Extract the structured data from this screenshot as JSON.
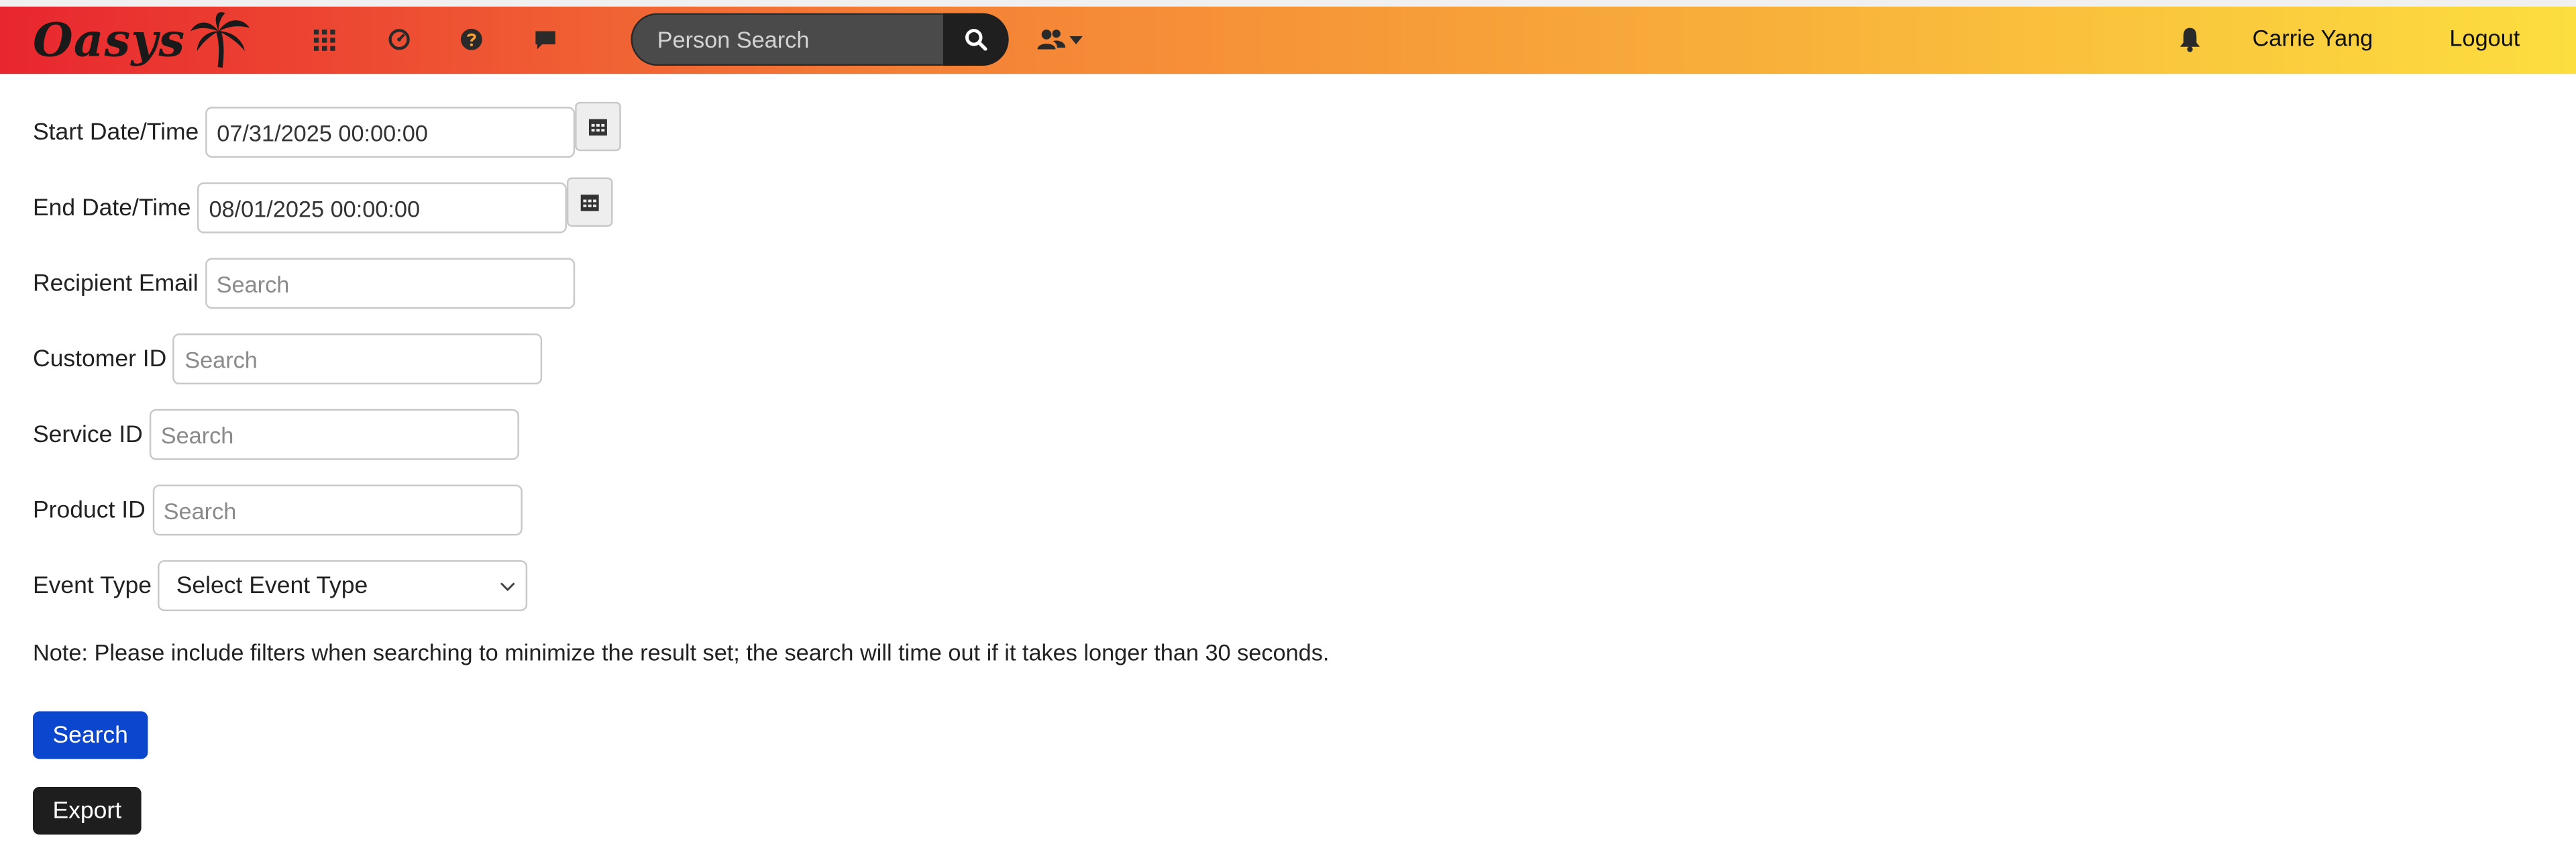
{
  "colors": {
    "navbar_gradient_start": "#e8262f",
    "navbar_gradient_mid": "#f47f36",
    "navbar_gradient_end": "#fcde3f",
    "search_button": "#0b46cf",
    "export_button": "#1e1e1e"
  },
  "header": {
    "logo_text": "Oasys",
    "logo_icon": "palm-tree-icon",
    "nav_icons": [
      "apps-grid-icon",
      "dashboard-gauge-icon",
      "help-icon",
      "chat-icon"
    ],
    "person_search": {
      "placeholder": "Person Search",
      "button_icon": "search-icon"
    },
    "people_menu_icon": "users-icon",
    "notifications_icon": "bell-icon",
    "user_name": "Carrie Yang",
    "logout_label": "Logout"
  },
  "form": {
    "start_datetime": {
      "label": "Start Date/Time",
      "value": "07/31/2025 00:00:00",
      "icon": "calendar-icon"
    },
    "end_datetime": {
      "label": "End Date/Time",
      "value": "08/01/2025 00:00:00",
      "icon": "calendar-icon"
    },
    "recipient_email": {
      "label": "Recipient Email",
      "placeholder": "Search"
    },
    "customer_id": {
      "label": "Customer ID",
      "placeholder": "Search"
    },
    "service_id": {
      "label": "Service ID",
      "placeholder": "Search"
    },
    "product_id": {
      "label": "Product ID",
      "placeholder": "Search"
    },
    "event_type": {
      "label": "Event Type",
      "selected": "Select Event Type"
    },
    "note": "Note: Please include filters when searching to minimize the result set; the search will time out if it takes longer than 30 seconds.",
    "search_label": "Search",
    "export_label": "Export"
  }
}
